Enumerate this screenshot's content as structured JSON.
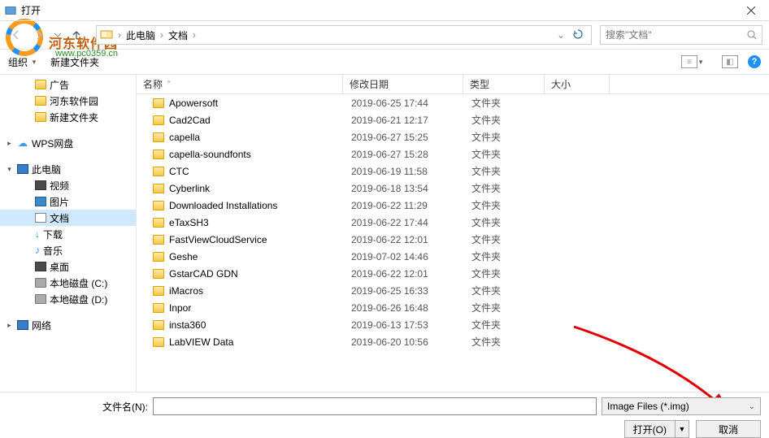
{
  "window": {
    "title": "打开"
  },
  "watermark": {
    "brand": "河东软件园",
    "url": "www.pc0359.cn"
  },
  "nav": {
    "pc": "此电脑",
    "folder": "文档",
    "search_placeholder": "搜索\"文档\""
  },
  "toolbar": {
    "organize": "组织",
    "newfolder": "新建文件夹"
  },
  "columns": {
    "name": "名称",
    "date": "修改日期",
    "type": "类型",
    "size": "大小"
  },
  "sidebar": {
    "items": [
      {
        "label": "广告",
        "kind": "folder",
        "indent": 28
      },
      {
        "label": "河东软件园",
        "kind": "folder",
        "indent": 28
      },
      {
        "label": "新建文件夹",
        "kind": "folder",
        "indent": 28
      }
    ],
    "wps": "WPS网盘",
    "pc": "此电脑",
    "subfolders": [
      {
        "label": "视频",
        "color": "#4a4a4a"
      },
      {
        "label": "图片",
        "color": "#3a8acc"
      },
      {
        "label": "文档",
        "sel": true
      },
      {
        "label": "下载",
        "color": "#2a8acc"
      },
      {
        "label": "音乐",
        "color": "#2a8acc"
      },
      {
        "label": "桌面",
        "color": "#4a4a4a"
      },
      {
        "label": "本地磁盘 (C:)",
        "kind": "drive"
      },
      {
        "label": "本地磁盘 (D:)",
        "kind": "drive"
      }
    ],
    "network": "网络"
  },
  "files": [
    {
      "name": "Apowersoft",
      "date": "2019-06-25 17:44",
      "type": "文件夹"
    },
    {
      "name": "Cad2Cad",
      "date": "2019-06-21 12:17",
      "type": "文件夹"
    },
    {
      "name": "capella",
      "date": "2019-06-27 15:25",
      "type": "文件夹"
    },
    {
      "name": "capella-soundfonts",
      "date": "2019-06-27 15:28",
      "type": "文件夹"
    },
    {
      "name": "CTC",
      "date": "2019-06-19 11:58",
      "type": "文件夹"
    },
    {
      "name": "Cyberlink",
      "date": "2019-06-18 13:54",
      "type": "文件夹"
    },
    {
      "name": "Downloaded Installations",
      "date": "2019-06-22 11:29",
      "type": "文件夹"
    },
    {
      "name": "eTaxSH3",
      "date": "2019-06-22 17:44",
      "type": "文件夹"
    },
    {
      "name": "FastViewCloudService",
      "date": "2019-06-22 12:01",
      "type": "文件夹"
    },
    {
      "name": "Geshe",
      "date": "2019-07-02 14:46",
      "type": "文件夹"
    },
    {
      "name": "GstarCAD GDN",
      "date": "2019-06-22 12:01",
      "type": "文件夹"
    },
    {
      "name": "iMacros",
      "date": "2019-06-25 16:33",
      "type": "文件夹"
    },
    {
      "name": "Inpor",
      "date": "2019-06-26 16:48",
      "type": "文件夹"
    },
    {
      "name": "insta360",
      "date": "2019-06-13 17:53",
      "type": "文件夹"
    },
    {
      "name": "LabVIEW Data",
      "date": "2019-06-20 10:56",
      "type": "文件夹"
    }
  ],
  "footer": {
    "fn_label": "文件名(N):",
    "fn_value": "",
    "filter": "Image Files (*.img)",
    "open": "打开(O)",
    "cancel": "取消"
  }
}
